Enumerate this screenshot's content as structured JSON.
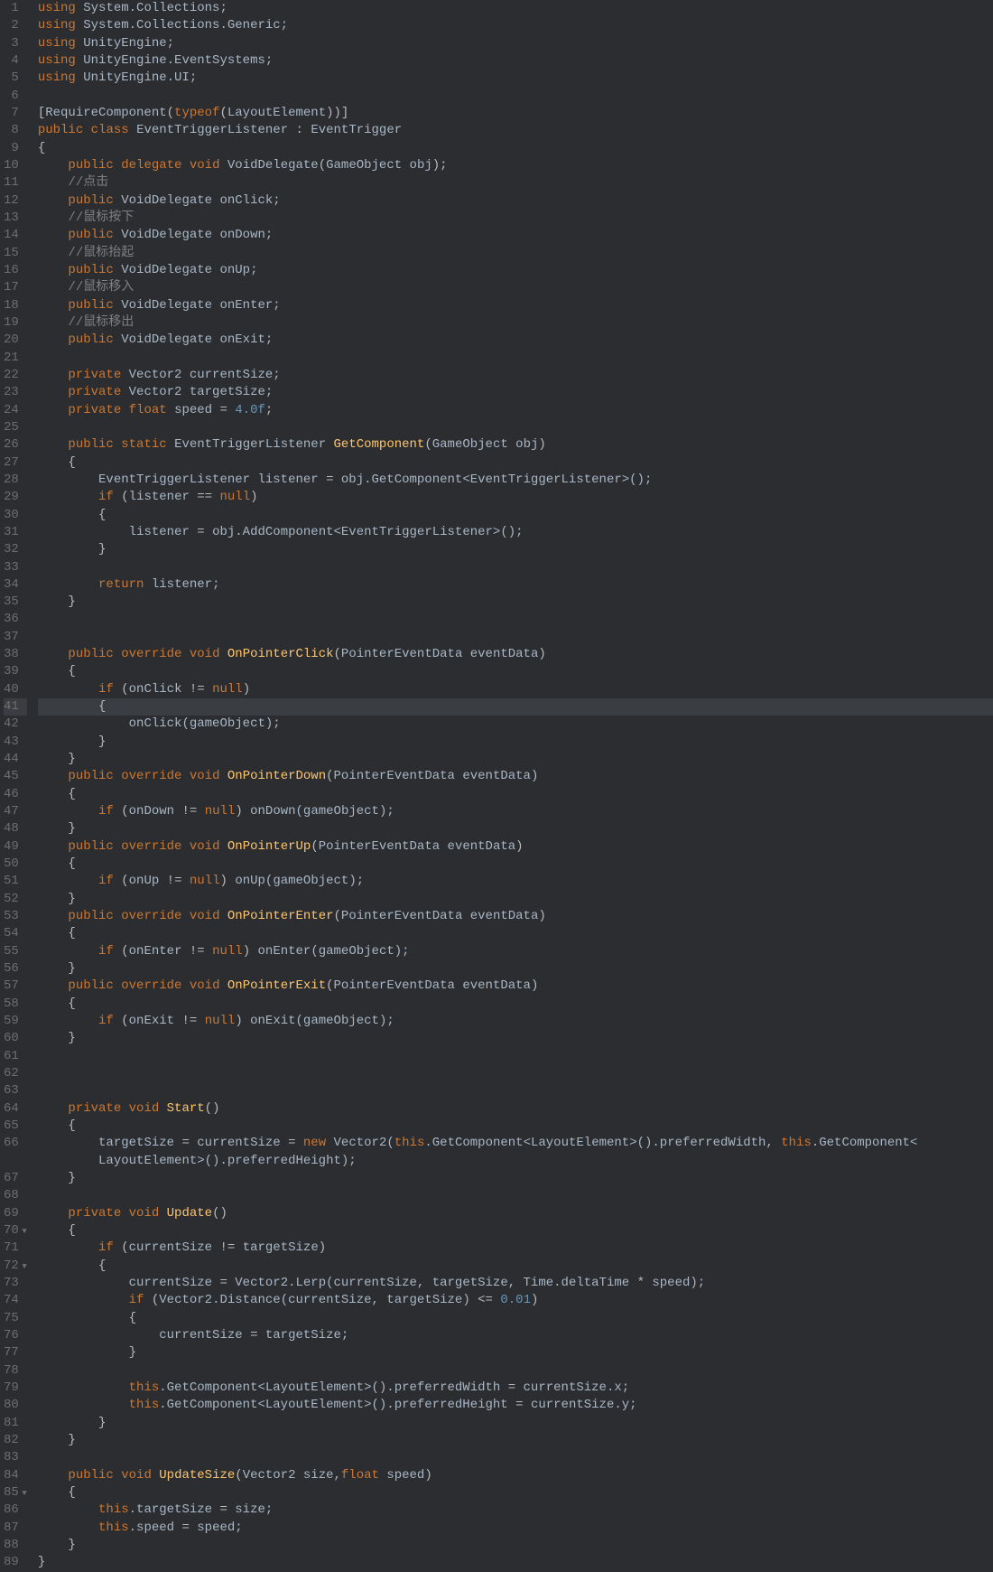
{
  "editor": {
    "highlighted_line": 41,
    "line_count": 89,
    "fold_lines": [
      70,
      72,
      85
    ],
    "code_lines": [
      {
        "n": 1,
        "h": "<span class='k'>using</span> <span class='t'>System.Collections;</span>"
      },
      {
        "n": 2,
        "h": "<span class='k'>using</span> <span class='t'>System.Collections.Generic;</span>"
      },
      {
        "n": 3,
        "h": "<span class='k'>using</span> <span class='t'>UnityEngine;</span>"
      },
      {
        "n": 4,
        "h": "<span class='k'>using</span> <span class='t'>UnityEngine.EventSystems;</span>"
      },
      {
        "n": 5,
        "h": "<span class='k'>using</span> <span class='t'>UnityEngine.UI;</span>"
      },
      {
        "n": 6,
        "h": ""
      },
      {
        "n": 7,
        "h": "<span class='p'>[</span><span class='t'>RequireComponent</span><span class='p'>(</span><span class='k'>typeof</span><span class='p'>(</span><span class='t'>LayoutElement</span><span class='p'>))]</span>"
      },
      {
        "n": 8,
        "h": "<span class='k'>public</span> <span class='k'>class</span> <span class='t'>EventTriggerListener</span> <span class='p'>:</span> <span class='t'>EventTrigger</span>"
      },
      {
        "n": 9,
        "h": "<span class='p'>{</span>"
      },
      {
        "n": 10,
        "h": "    <span class='k'>public</span> <span class='k'>delegate</span> <span class='k'>void</span> <span class='t'>VoidDelegate</span><span class='p'>(</span><span class='t'>GameObject obj</span><span class='p'>);</span>"
      },
      {
        "n": 11,
        "h": "    <span class='c'>//点击</span>"
      },
      {
        "n": 12,
        "h": "    <span class='k'>public</span> <span class='t'>VoidDelegate onClick;</span>"
      },
      {
        "n": 13,
        "h": "    <span class='c'>//鼠标按下</span>"
      },
      {
        "n": 14,
        "h": "    <span class='k'>public</span> <span class='t'>VoidDelegate onDown;</span>"
      },
      {
        "n": 15,
        "h": "    <span class='c'>//鼠标抬起</span>"
      },
      {
        "n": 16,
        "h": "    <span class='k'>public</span> <span class='t'>VoidDelegate onUp;</span>"
      },
      {
        "n": 17,
        "h": "    <span class='c'>//鼠标移入</span>"
      },
      {
        "n": 18,
        "h": "    <span class='k'>public</span> <span class='t'>VoidDelegate onEnter;</span>"
      },
      {
        "n": 19,
        "h": "    <span class='c'>//鼠标移出</span>"
      },
      {
        "n": 20,
        "h": "    <span class='k'>public</span> <span class='t'>VoidDelegate onExit;</span>"
      },
      {
        "n": 21,
        "h": ""
      },
      {
        "n": 22,
        "h": "    <span class='k'>private</span> <span class='t'>Vector2 currentSize;</span>"
      },
      {
        "n": 23,
        "h": "    <span class='k'>private</span> <span class='t'>Vector2 targetSize;</span>"
      },
      {
        "n": 24,
        "h": "    <span class='k'>private</span> <span class='k'>float</span> <span class='t'>speed</span> <span class='p'>=</span> <span class='n'>4.0f</span><span class='p'>;</span>"
      },
      {
        "n": 25,
        "h": ""
      },
      {
        "n": 26,
        "h": "    <span class='k'>public</span> <span class='k'>static</span> <span class='t'>EventTriggerListener</span> <span class='m'>GetComponent</span><span class='p'>(</span><span class='t'>GameObject obj</span><span class='p'>)</span>"
      },
      {
        "n": 27,
        "h": "    <span class='p'>{</span>"
      },
      {
        "n": 28,
        "h": "        <span class='t'>EventTriggerListener listener</span> <span class='p'>=</span> <span class='t'>obj.GetComponent&lt;EventTriggerListener&gt;();</span>"
      },
      {
        "n": 29,
        "h": "        <span class='k'>if</span> <span class='p'>(</span><span class='t'>listener</span> <span class='p'>==</span> <span class='k'>null</span><span class='p'>)</span>"
      },
      {
        "n": 30,
        "h": "        <span class='p'>{</span>"
      },
      {
        "n": 31,
        "h": "            <span class='t'>listener</span> <span class='p'>=</span> <span class='t'>obj.AddComponent&lt;EventTriggerListener&gt;();</span>"
      },
      {
        "n": 32,
        "h": "        <span class='p'>}</span>"
      },
      {
        "n": 33,
        "h": ""
      },
      {
        "n": 34,
        "h": "        <span class='k'>return</span> <span class='t'>listener;</span>"
      },
      {
        "n": 35,
        "h": "    <span class='p'>}</span>"
      },
      {
        "n": 36,
        "h": ""
      },
      {
        "n": 37,
        "h": ""
      },
      {
        "n": 38,
        "h": "    <span class='k'>public</span> <span class='k'>override</span> <span class='k'>void</span> <span class='m'>OnPointerClick</span><span class='p'>(</span><span class='t'>PointerEventData eventData</span><span class='p'>)</span>"
      },
      {
        "n": 39,
        "h": "    <span class='p'>{</span>"
      },
      {
        "n": 40,
        "h": "        <span class='k'>if</span> <span class='p'>(</span><span class='t'>onClick</span> <span class='p'>!=</span> <span class='k'>null</span><span class='p'>)</span>"
      },
      {
        "n": 41,
        "h": "        <span class='p'>{</span>",
        "hl": true
      },
      {
        "n": 42,
        "h": "            <span class='t'>onClick(gameObject);</span>"
      },
      {
        "n": 43,
        "h": "        <span class='p'>}</span>"
      },
      {
        "n": 44,
        "h": "    <span class='p'>}</span>"
      },
      {
        "n": 45,
        "h": "    <span class='k'>public</span> <span class='k'>override</span> <span class='k'>void</span> <span class='m'>OnPointerDown</span><span class='p'>(</span><span class='t'>PointerEventData eventData</span><span class='p'>)</span>"
      },
      {
        "n": 46,
        "h": "    <span class='p'>{</span>"
      },
      {
        "n": 47,
        "h": "        <span class='k'>if</span> <span class='p'>(</span><span class='t'>onDown</span> <span class='p'>!=</span> <span class='k'>null</span><span class='p'>)</span> <span class='t'>onDown(gameObject);</span>"
      },
      {
        "n": 48,
        "h": "    <span class='p'>}</span>"
      },
      {
        "n": 49,
        "h": "    <span class='k'>public</span> <span class='k'>override</span> <span class='k'>void</span> <span class='m'>OnPointerUp</span><span class='p'>(</span><span class='t'>PointerEventData eventData</span><span class='p'>)</span>"
      },
      {
        "n": 50,
        "h": "    <span class='p'>{</span>"
      },
      {
        "n": 51,
        "h": "        <span class='k'>if</span> <span class='p'>(</span><span class='t'>onUp</span> <span class='p'>!=</span> <span class='k'>null</span><span class='p'>)</span> <span class='t'>onUp(gameObject);</span>"
      },
      {
        "n": 52,
        "h": "    <span class='p'>}</span>"
      },
      {
        "n": 53,
        "h": "    <span class='k'>public</span> <span class='k'>override</span> <span class='k'>void</span> <span class='m'>OnPointerEnter</span><span class='p'>(</span><span class='t'>PointerEventData eventData</span><span class='p'>)</span>"
      },
      {
        "n": 54,
        "h": "    <span class='p'>{</span>"
      },
      {
        "n": 55,
        "h": "        <span class='k'>if</span> <span class='p'>(</span><span class='t'>onEnter</span> <span class='p'>!=</span> <span class='k'>null</span><span class='p'>)</span> <span class='t'>onEnter(gameObject);</span>"
      },
      {
        "n": 56,
        "h": "    <span class='p'>}</span>"
      },
      {
        "n": 57,
        "h": "    <span class='k'>public</span> <span class='k'>override</span> <span class='k'>void</span> <span class='m'>OnPointerExit</span><span class='p'>(</span><span class='t'>PointerEventData eventData</span><span class='p'>)</span>"
      },
      {
        "n": 58,
        "h": "    <span class='p'>{</span>"
      },
      {
        "n": 59,
        "h": "        <span class='k'>if</span> <span class='p'>(</span><span class='t'>onExit</span> <span class='p'>!=</span> <span class='k'>null</span><span class='p'>)</span> <span class='t'>onExit(gameObject);</span>"
      },
      {
        "n": 60,
        "h": "    <span class='p'>}</span>"
      },
      {
        "n": 61,
        "h": ""
      },
      {
        "n": 62,
        "h": ""
      },
      {
        "n": 63,
        "h": ""
      },
      {
        "n": 64,
        "h": "    <span class='k'>private</span> <span class='k'>void</span> <span class='m'>Start</span><span class='p'>()</span>"
      },
      {
        "n": 65,
        "h": "    <span class='p'>{</span>"
      },
      {
        "n": 66,
        "h": "        <span class='t'>targetSize</span> <span class='p'>=</span> <span class='t'>currentSize</span> <span class='p'>=</span> <span class='k'>new</span> <span class='t'>Vector2(</span><span class='k'>this</span><span class='t'>.GetComponent&lt;LayoutElement&gt;().preferredWidth,</span> <span class='k'>this</span><span class='t'>.GetComponent&lt;</span>"
      },
      {
        "n": "",
        "h": "        <span class='t'>LayoutElement&gt;().preferredHeight);</span>",
        "wrap": true
      },
      {
        "n": 67,
        "h": "    <span class='p'>}</span>"
      },
      {
        "n": 68,
        "h": ""
      },
      {
        "n": 69,
        "h": "    <span class='k'>private</span> <span class='k'>void</span> <span class='m'>Update</span><span class='p'>()</span>"
      },
      {
        "n": 70,
        "h": "    <span class='p'>{</span>"
      },
      {
        "n": 71,
        "h": "        <span class='k'>if</span> <span class='p'>(</span><span class='t'>currentSize</span> <span class='p'>!=</span> <span class='t'>targetSize</span><span class='p'>)</span>"
      },
      {
        "n": 72,
        "h": "        <span class='p'>{</span>"
      },
      {
        "n": 73,
        "h": "            <span class='t'>currentSize</span> <span class='p'>=</span> <span class='t'>Vector2.Lerp(currentSize, targetSize, Time.deltaTime</span> <span class='p'>*</span> <span class='t'>speed);</span>"
      },
      {
        "n": 74,
        "h": "            <span class='k'>if</span> <span class='p'>(</span><span class='t'>Vector2.Distance(currentSize, targetSize)</span> <span class='p'>&lt;=</span> <span class='n'>0.01</span><span class='p'>)</span>"
      },
      {
        "n": 75,
        "h": "            <span class='p'>{</span>"
      },
      {
        "n": 76,
        "h": "                <span class='t'>currentSize</span> <span class='p'>=</span> <span class='t'>targetSize;</span>"
      },
      {
        "n": 77,
        "h": "            <span class='p'>}</span>"
      },
      {
        "n": 78,
        "h": ""
      },
      {
        "n": 79,
        "h": "            <span class='k'>this</span><span class='t'>.GetComponent&lt;LayoutElement&gt;().preferredWidth</span> <span class='p'>=</span> <span class='t'>currentSize.x;</span>"
      },
      {
        "n": 80,
        "h": "            <span class='k'>this</span><span class='t'>.GetComponent&lt;LayoutElement&gt;().preferredHeight</span> <span class='p'>=</span> <span class='t'>currentSize.y;</span>"
      },
      {
        "n": 81,
        "h": "        <span class='p'>}</span>"
      },
      {
        "n": 82,
        "h": "    <span class='p'>}</span>"
      },
      {
        "n": 83,
        "h": ""
      },
      {
        "n": 84,
        "h": "    <span class='k'>public</span> <span class='k'>void</span> <span class='m'>UpdateSize</span><span class='p'>(</span><span class='t'>Vector2 size,</span><span class='k'>float</span> <span class='t'>speed</span><span class='p'>)</span>"
      },
      {
        "n": 85,
        "h": "    <span class='p'>{</span>"
      },
      {
        "n": 86,
        "h": "        <span class='k'>this</span><span class='t'>.targetSize</span> <span class='p'>=</span> <span class='t'>size;</span>"
      },
      {
        "n": 87,
        "h": "        <span class='k'>this</span><span class='t'>.speed</span> <span class='p'>=</span> <span class='t'>speed;</span>"
      },
      {
        "n": 88,
        "h": "    <span class='p'>}</span>"
      },
      {
        "n": 89,
        "h": "<span class='p'>}</span>"
      }
    ]
  }
}
